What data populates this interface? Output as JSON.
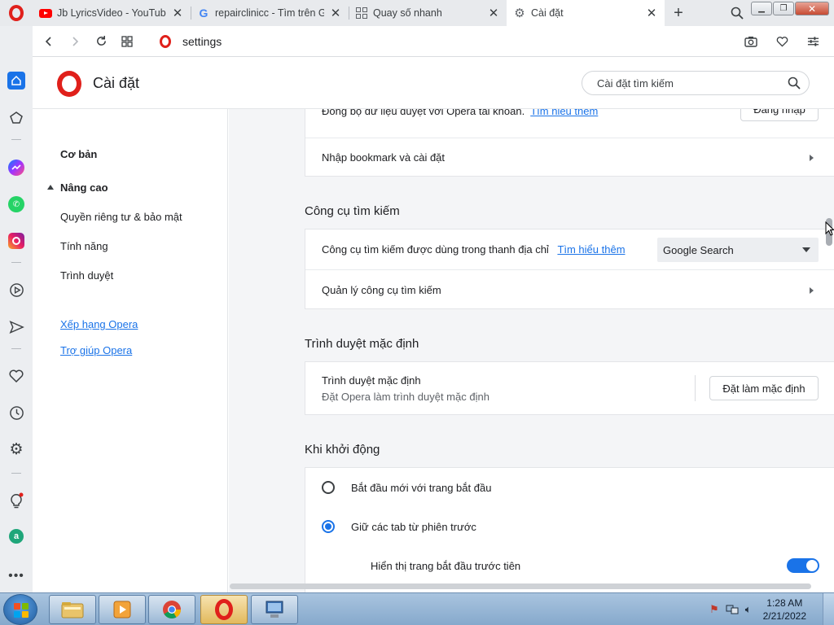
{
  "tabs": [
    {
      "title": "Jb LyricsVideo - YouTube",
      "favicon": "youtube-icon",
      "active": false
    },
    {
      "title": "repairclinicc - Tìm trên Goo",
      "favicon": "google-icon",
      "active": false
    },
    {
      "title": "Quay số nhanh",
      "favicon": "speed-dial-icon",
      "active": false
    },
    {
      "title": "Cài đặt",
      "favicon": "gear-icon",
      "active": true
    }
  ],
  "tab_close_glyph": "✕",
  "new_tab_glyph": "+",
  "address": {
    "url": "settings"
  },
  "settings_header": {
    "title": "Cài đặt",
    "search_placeholder": "Cài đặt tìm kiếm"
  },
  "left_nav": {
    "basic": "Cơ bản",
    "advanced": "Nâng cao",
    "items": [
      "Quyền riêng tư & bảo mật",
      "Tính năng",
      "Trình duyệt"
    ],
    "links": [
      "Xếp hạng Opera",
      "Trợ giúp Opera"
    ]
  },
  "sync_card": {
    "text": "Đồng bộ dữ liệu duyệt với Opera tài khoản.",
    "learn_more": "Tìm hiểu thêm",
    "login_button": "Đăng nhập",
    "import_label": "Nhập bookmark và cài đặt"
  },
  "search_engine": {
    "section_title": "Công cụ tìm kiếm",
    "address_bar_label": "Công cụ tìm kiếm được dùng trong thanh địa chỉ",
    "learn_more": "Tìm hiểu thêm",
    "selected": "Google Search",
    "manage_label": "Quản lý công cụ tìm kiếm"
  },
  "default_browser": {
    "section_title": "Trình duyệt mặc định",
    "label": "Trình duyệt mặc định",
    "sublabel": "Đặt Opera làm trình duyệt mặc định",
    "button": "Đặt làm mặc định"
  },
  "startup": {
    "section_title": "Khi khởi động",
    "options": [
      {
        "label": "Bắt đầu mới với trang bắt đầu",
        "checked": false
      },
      {
        "label": "Giữ các tab từ phiên trước",
        "checked": true
      }
    ],
    "show_start_page_first": {
      "label": "Hiển thị trang bắt đầu trước tiên",
      "on": true
    }
  },
  "taskbar": {
    "time": "1:28 AM",
    "date": "2/21/2022"
  },
  "colors": {
    "accent": "#1a73e8",
    "opera_red": "#e0201b"
  }
}
